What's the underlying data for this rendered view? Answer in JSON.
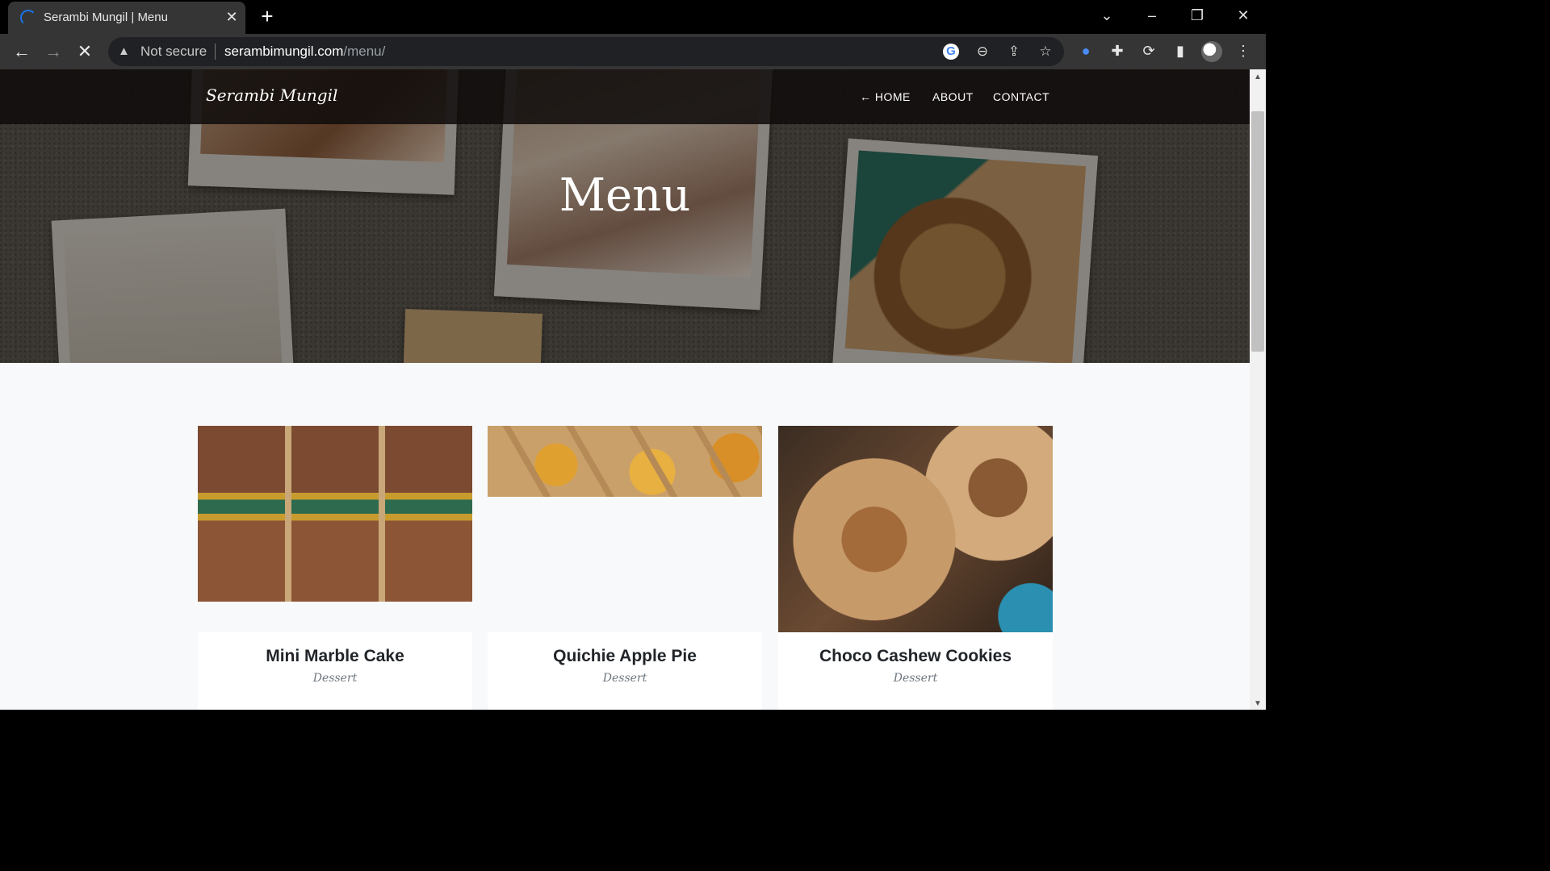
{
  "browser": {
    "tab_title": "Serambi Mungil | Menu",
    "new_tab": "+",
    "security_label": "Not secure",
    "url_domain": "serambimungil.com",
    "url_path": "/menu/"
  },
  "site": {
    "brand": "Serambi Mungil",
    "nav": {
      "home": "HOME",
      "about": "ABOUT",
      "contact": "CONTACT"
    },
    "hero_title": "Menu"
  },
  "menu_items": [
    {
      "title": "Mini Marble Cake",
      "category": "Dessert"
    },
    {
      "title": "Quichie Apple Pie",
      "category": "Dessert"
    },
    {
      "title": "Choco Cashew Cookies",
      "category": "Dessert"
    }
  ],
  "colors": {
    "page_bg": "#f8f9fa",
    "navbar_bg": "#0f0c0a",
    "chrome_bg": "#353535",
    "omnibox_bg": "#202124"
  }
}
